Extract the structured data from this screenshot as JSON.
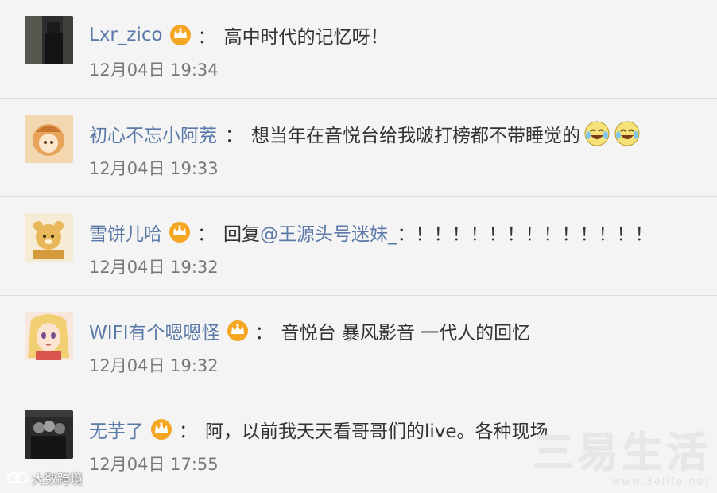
{
  "comments": [
    {
      "user": "Lxr_zico",
      "vip": true,
      "colon": "：",
      "text": "高中时代的记忆呀！",
      "time": "12月04日 19:34",
      "avatar": "dark-figure"
    },
    {
      "user": "初心不忘小阿茺",
      "vip": false,
      "colon": "：",
      "text": "想当年在音悦台给我啵打榜都不带睡觉的",
      "time": "12月04日 19:33",
      "emojis": [
        "laugh-cry-emoji",
        "laugh-cry-emoji"
      ],
      "avatar": "cartoon-orange"
    },
    {
      "user": "雪饼儿哈",
      "vip": true,
      "colon": "：",
      "text_prefix": "回复",
      "mention": "@王源头号迷妹_",
      "text": "：！！！！！！！！！！！！！",
      "time": "12月04日 19:32",
      "avatar": "cartoon-bear"
    },
    {
      "user": "WIFI有个嗯嗯怪",
      "vip": true,
      "colon": "：",
      "text": "音悦台 暴风影音 一代人的回忆",
      "time": "12月04日 19:32",
      "avatar": "anime-girl"
    },
    {
      "user": "无芋了",
      "vip": true,
      "colon": "：",
      "text": "阿，以前我天天看哥哥们的live。各种现场",
      "time": "12月04日 17:55",
      "avatar": "dark-group"
    }
  ],
  "watermarks": {
    "left": "大数跨境",
    "right_big": "三易生活",
    "right_small": "www.3elife.net"
  },
  "colors": {
    "username": "#5b7aa8",
    "text": "#333333",
    "time": "#777777",
    "background": "#f4f4f4",
    "vip_crown": "#f5a623"
  }
}
